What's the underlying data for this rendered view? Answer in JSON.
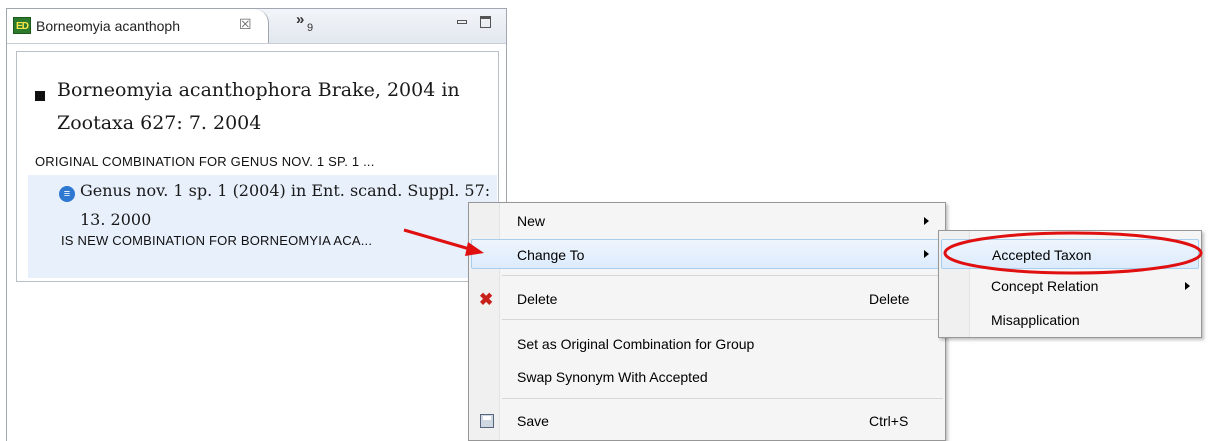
{
  "editor": {
    "tab_title": "Borneomyia acanthoph",
    "tab_icon_text": "ED",
    "tab_close": "☒",
    "overflow_symbol": "»",
    "overflow_count": "9",
    "accepted": {
      "name": "Borneomyia acanthophora Brake, 2004 in Zootaxa 627: 7. 2004",
      "group_label": "ORIGINAL COMBINATION FOR GENUS NOV. 1 SP. 1 ..."
    },
    "synonym": {
      "icon": "≡",
      "name": "Genus nov. 1 sp. 1 (2004) in Ent. scand. Suppl. 57: 13. 2000",
      "label": "IS NEW COMBINATION FOR BORNEOMYIA ACA..."
    }
  },
  "context_menu": {
    "items": [
      {
        "label": "New",
        "shortcut": ""
      },
      {
        "label": "Change To",
        "shortcut": ""
      },
      {
        "label": "Delete",
        "shortcut": "Delete"
      },
      {
        "label": "Set as Original Combination for Group",
        "shortcut": ""
      },
      {
        "label": "Swap Synonym With Accepted",
        "shortcut": ""
      },
      {
        "label": "Save",
        "shortcut": "Ctrl+S"
      }
    ],
    "delete_icon": "✖"
  },
  "submenu": {
    "items": [
      {
        "label": "Accepted Taxon"
      },
      {
        "label": "Concept Relation"
      },
      {
        "label": "Misapplication"
      }
    ]
  },
  "colors": {
    "annotation_red": "#e01010",
    "selection_bg": "#e7f0fb",
    "menu_highlight_border": "#a9cfee"
  }
}
